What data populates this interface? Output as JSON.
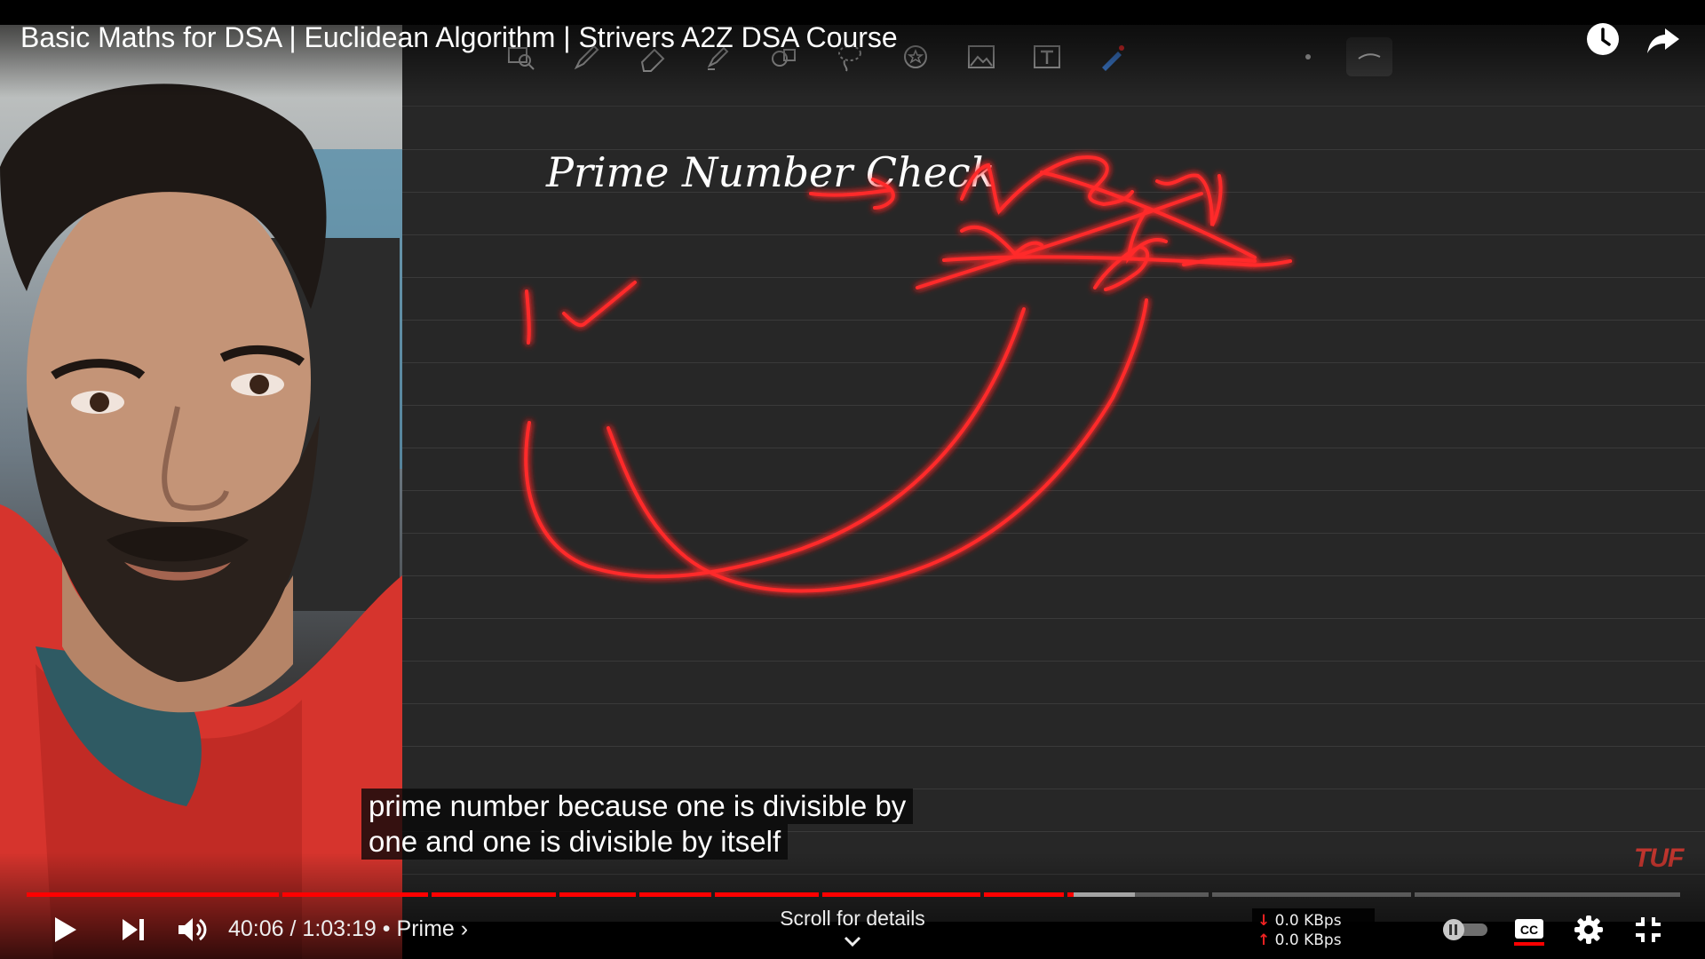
{
  "video": {
    "title": "Basic Maths for DSA | Euclidean Algorithm | Strivers A2Z DSA Course",
    "watermark": "TUF"
  },
  "board": {
    "heading": "Prime Number Check"
  },
  "captions": {
    "line1": "prime number because one is divisible by",
    "line2": "one and one is divisible by itself"
  },
  "controls": {
    "current_time": "40:06",
    "duration": "1:03:19",
    "separator": "•",
    "chapter": "Prime",
    "chapter_chevron": "›",
    "scroll_hint": "Scroll for details",
    "progress_fraction": 0.633,
    "buffer_fraction": 0.67,
    "autoplay": false,
    "captions_on": true
  },
  "netstats": {
    "down_arrow": "↓",
    "up_arrow": "↑",
    "download": "0.0 KBps",
    "upload": "0.0 KBps"
  },
  "colors": {
    "progress_played": "#ff0000",
    "ink_red": "#ff2a2a",
    "ink_white": "#ffffff",
    "board_bg": "#272727",
    "watermark": "#c0352e"
  },
  "icons": {
    "watch_later": "clock-icon",
    "share": "share-arrow-icon",
    "play": "play-icon",
    "next": "next-icon",
    "volume": "volume-icon",
    "autoplay": "autoplay-toggle-icon",
    "subtitles": "cc-icon",
    "settings": "gear-icon",
    "exit_fullscreen": "exit-fullscreen-icon"
  }
}
